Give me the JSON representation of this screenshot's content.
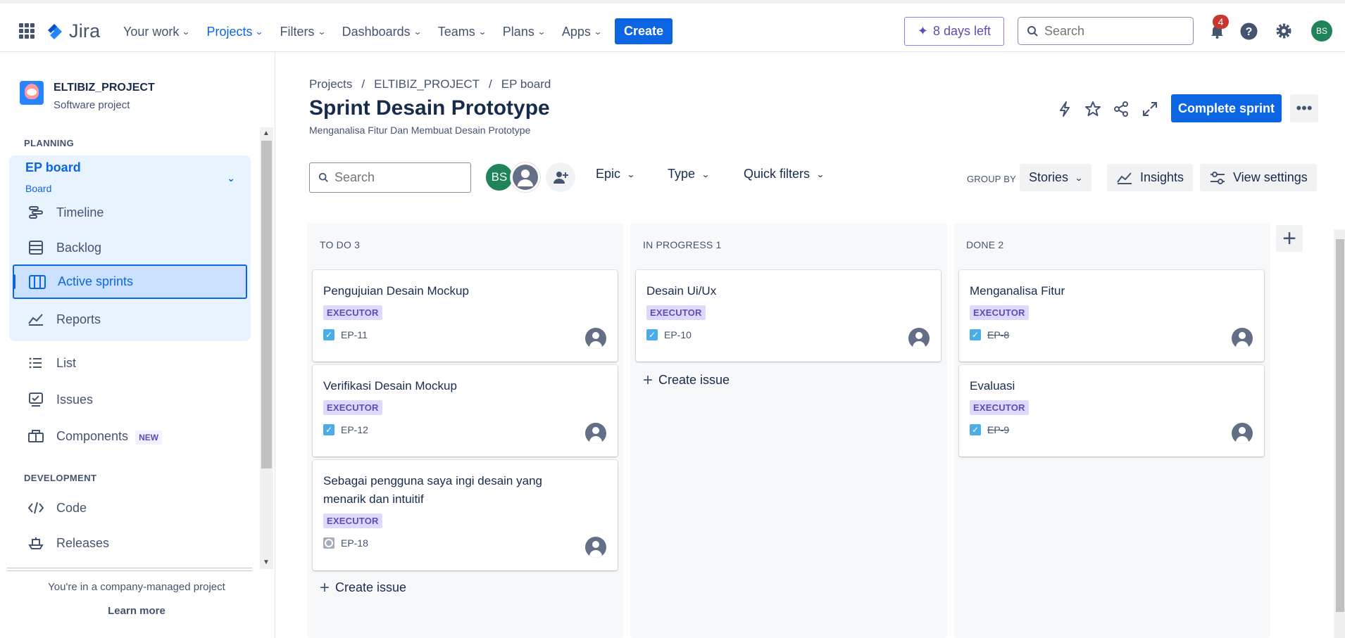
{
  "topbar": {
    "logo_text": "Jira",
    "nav": [
      {
        "label": "Your work",
        "active": false
      },
      {
        "label": "Projects",
        "active": true
      },
      {
        "label": "Filters",
        "active": false
      },
      {
        "label": "Dashboards",
        "active": false
      },
      {
        "label": "Teams",
        "active": false
      },
      {
        "label": "Plans",
        "active": false
      },
      {
        "label": "Apps",
        "active": false
      }
    ],
    "create_label": "Create",
    "trial_label": "8 days left",
    "search_placeholder": "Search",
    "notification_count": "4",
    "avatar_initials": "BS"
  },
  "sidebar": {
    "project_name": "ELTIBIZ_PROJECT",
    "project_type": "Software project",
    "planning_label": "PLANNING",
    "board_title": "EP board",
    "board_subtitle": "Board",
    "items": [
      {
        "label": "Timeline",
        "icon": "timeline-icon"
      },
      {
        "label": "Backlog",
        "icon": "backlog-icon"
      },
      {
        "label": "Active sprints",
        "icon": "board-columns-icon"
      },
      {
        "label": "Reports",
        "icon": "reports-chart-icon"
      },
      {
        "label": "List",
        "icon": "list-icon"
      },
      {
        "label": "Issues",
        "icon": "issues-icon"
      },
      {
        "label": "Components",
        "icon": "components-icon",
        "badge": "NEW"
      }
    ],
    "development_label": "DEVELOPMENT",
    "dev_items": [
      {
        "label": "Code",
        "icon": "code-icon"
      },
      {
        "label": "Releases",
        "icon": "releases-icon"
      }
    ],
    "footer_text": "You're in a company-managed project",
    "learn_more": "Learn more"
  },
  "main": {
    "breadcrumb": [
      "Projects",
      "/",
      "ELTIBIZ_PROJECT",
      "/",
      "EP board"
    ],
    "title": "Sprint Desain Prototype",
    "subtitle": "Menganalisa Fitur Dan Membuat Desain Prototype",
    "complete_sprint_label": "Complete sprint",
    "more_label": "•••",
    "search_placeholder": "Search",
    "avatar_bs": "BS",
    "filters": [
      "Epic",
      "Type",
      "Quick filters"
    ],
    "group_by_label": "GROUP BY",
    "group_by_value": "Stories",
    "insights_label": "Insights",
    "view_settings_label": "View settings",
    "create_issue_label": "Create issue",
    "columns": [
      {
        "title": "TO DO 3",
        "cards": [
          {
            "title": "Pengujuian Desain Mockup",
            "epic": "EXECUTOR",
            "key": "EP-11",
            "type": "task",
            "done": false
          },
          {
            "title": "Verifikasi Desain Mockup",
            "epic": "EXECUTOR",
            "key": "EP-12",
            "type": "task",
            "done": false
          },
          {
            "title": "Sebagai pengguna saya ingi desain yang menarik dan intuitif",
            "epic": "EXECUTOR",
            "key": "EP-18",
            "type": "subtask",
            "done": false
          }
        ]
      },
      {
        "title": "IN PROGRESS 1",
        "cards": [
          {
            "title": "Desain Ui/Ux",
            "epic": "EXECUTOR",
            "key": "EP-10",
            "type": "task",
            "done": false
          }
        ]
      },
      {
        "title": "DONE 2",
        "cards": [
          {
            "title": "Menganalisa Fitur",
            "epic": "EXECUTOR",
            "key": "EP-8",
            "type": "task",
            "done": true
          },
          {
            "title": "Evaluasi",
            "epic": "EXECUTOR",
            "key": "EP-9",
            "type": "task",
            "done": true
          }
        ]
      }
    ]
  }
}
